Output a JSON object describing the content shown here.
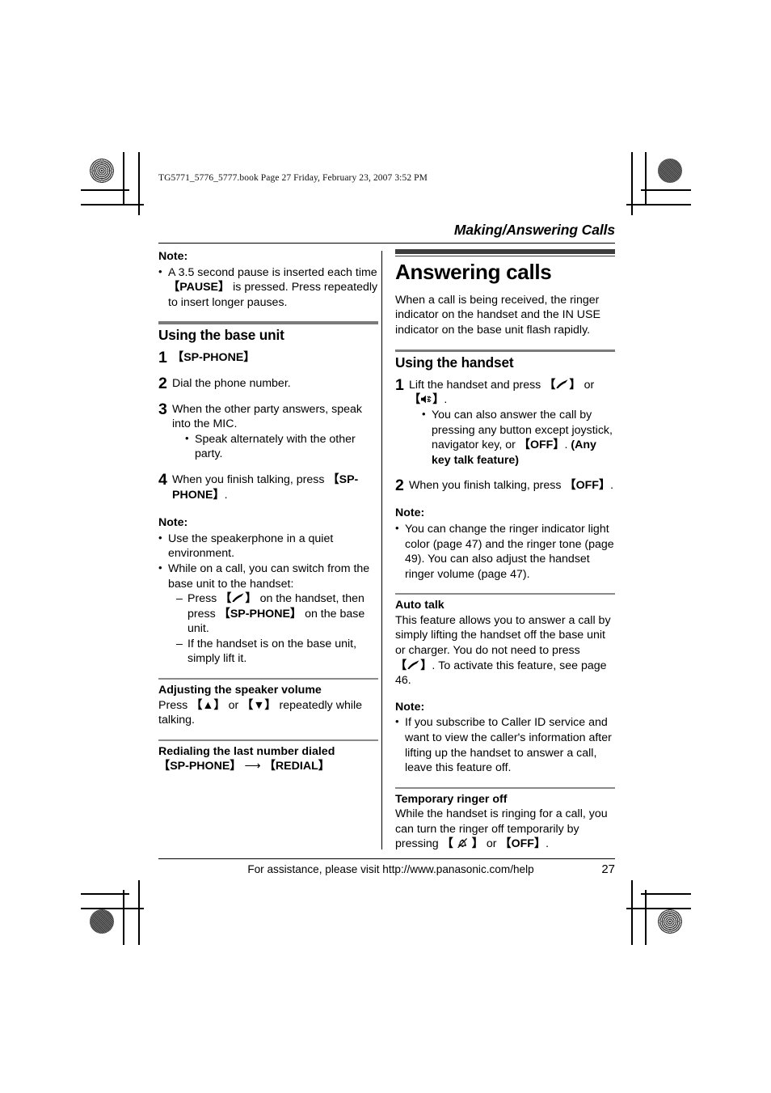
{
  "page": {
    "filestamp": "TG5771_5776_5777.book  Page 27  Friday, February 23, 2007  3:52 PM",
    "running_head": "Making/Answering Calls",
    "footer_text": "For assistance, please visit http://www.panasonic.com/help",
    "page_number": "27"
  },
  "left_column": {
    "note1": {
      "heading": "Note:",
      "items": [
        {
          "pre": "A 3.5 second pause is inserted each time ",
          "key": "【PAUSE】",
          "post": " is pressed. Press repeatedly to insert longer pauses."
        }
      ]
    },
    "section_base_unit": {
      "heading": "Using the base unit",
      "steps": [
        {
          "num": "1",
          "key": "【SP-PHONE】",
          "text": ""
        },
        {
          "num": "2",
          "text": "Dial the phone number."
        },
        {
          "num": "3",
          "text": "When the other party answers, speak into the MIC.",
          "bullets": [
            "Speak alternately with the other party."
          ]
        },
        {
          "num": "4",
          "pre": "When you finish talking, press ",
          "key": "【SP-PHONE】",
          "post": "."
        }
      ]
    },
    "note2": {
      "heading": "Note:",
      "item1": "Use the speakerphone in a quiet environment.",
      "item2_lead": "While on a call, you can switch from the base unit to the handset:",
      "sub1_pre": "Press ",
      "sub1_icon": "talk-handset-icon",
      "sub1_mid": " on the handset, then press ",
      "sub1_key": "【SP-PHONE】",
      "sub1_post": " on the base unit.",
      "sub2": "If the handset is on the base unit, simply lift it."
    },
    "sub_speaker_volume": {
      "heading": "Adjusting the speaker volume",
      "pre": "Press ",
      "key_up": "【▲】",
      "mid": " or ",
      "key_down": "【▼】",
      "post": " repeatedly while talking."
    },
    "sub_redial": {
      "heading": "Redialing the last number dialed",
      "key1": "【SP-PHONE】",
      "arrow": "⟶",
      "key2": "【REDIAL】"
    }
  },
  "right_column": {
    "chapter_title": "Answering calls",
    "intro": "When a call is being received, the ringer indicator on the handset and the IN USE indicator on the base unit flash rapidly.",
    "section_handset": {
      "heading": "Using the handset",
      "step1": {
        "num": "1",
        "pre": "Lift the handset and press ",
        "icon1": "talk-handset-icon",
        "mid": " or ",
        "icon2": "speakerphone-icon",
        "post": ".",
        "bullet_pre": "You can also answer the call by pressing any button except joystick, navigator key, or ",
        "bullet_key": "【OFF】",
        "bullet_mid": ". ",
        "bullet_bold": "(Any key talk feature)"
      },
      "step2": {
        "num": "2",
        "pre": "When you finish talking, press ",
        "key": "【OFF】",
        "post": "."
      }
    },
    "note1": {
      "heading": "Note:",
      "items": [
        "You can change the ringer indicator light color (page 47) and the ringer tone (page 49). You can also adjust the handset ringer volume (page 47)."
      ]
    },
    "sub_auto_talk": {
      "heading": "Auto talk",
      "pre": "This feature allows you to answer a call by simply lifting the handset off the base unit or charger. You do not need to press ",
      "icon": "talk-handset-icon",
      "post": ". To activate this feature, see page 46."
    },
    "note2": {
      "heading": "Note:",
      "items": [
        "If you subscribe to Caller ID service and want to view the caller's information after lifting up the handset to answer a call, leave this feature off."
      ]
    },
    "sub_temp_ringer": {
      "heading": "Temporary ringer off",
      "pre": "While the handset is ringing for a call, you can turn the ringer off temporarily by pressing ",
      "icon": "ringer-off-icon",
      "mid": " or ",
      "key": "【OFF】",
      "post": "."
    }
  },
  "colors": {
    "chapter_rule": "#3d3d3d",
    "section_rule": "#7a7a7a",
    "sub_rule": "#8a8a8a",
    "text": "#000000"
  }
}
